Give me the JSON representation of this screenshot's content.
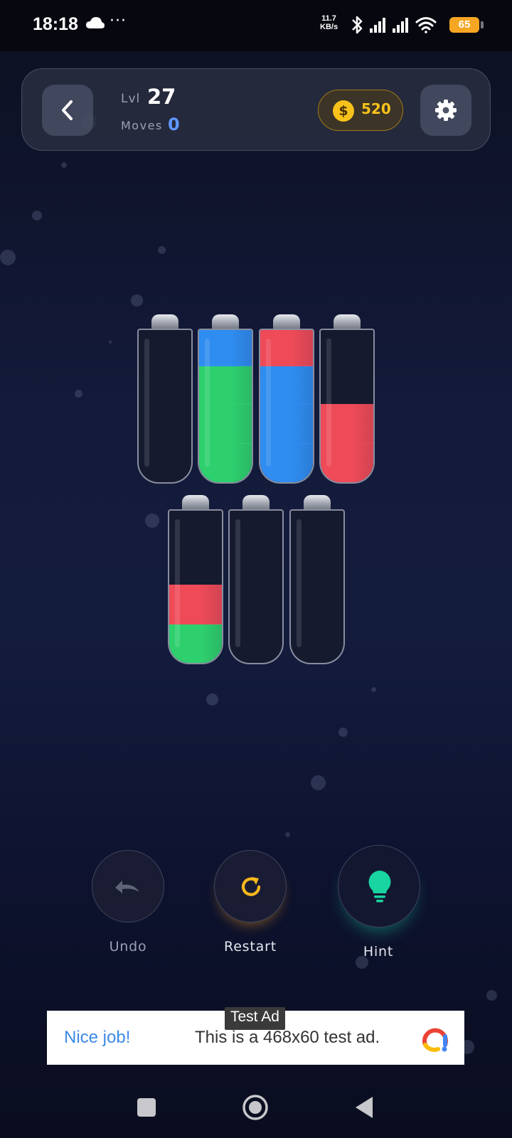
{
  "status_bar": {
    "time": "18:18",
    "more": "···",
    "speed_value": "11.7",
    "speed_unit": "KB/s",
    "battery": "65",
    "icons": [
      "cloud-icon",
      "bluetooth-icon",
      "signal-icon",
      "signal-icon",
      "wifi-icon",
      "battery-icon"
    ]
  },
  "header": {
    "level_label": "Lvl",
    "level_value": "27",
    "moves_label": "Moves",
    "moves_value": "0",
    "coins_symbol": "$",
    "coins_value": "520",
    "back_icon": "chevron-left-icon",
    "settings_icon": "gear-icon"
  },
  "colors": {
    "blue": "#2f8cf0",
    "green": "#2ed06e",
    "red": "#ee4a58",
    "gold": "#f8c21c",
    "hint": "#18d4a0",
    "accent": "#5f97ff"
  },
  "tubes": [
    {
      "row": 1,
      "layers": []
    },
    {
      "row": 1,
      "layers": [
        "green",
        "green",
        "green",
        "blue"
      ]
    },
    {
      "row": 1,
      "layers": [
        "blue",
        "blue",
        "blue",
        "red"
      ]
    },
    {
      "row": 1,
      "layers": [
        "red",
        "red"
      ]
    },
    {
      "row": 2,
      "layers": [
        "green",
        "red"
      ]
    },
    {
      "row": 2,
      "layers": []
    },
    {
      "row": 2,
      "layers": []
    }
  ],
  "tube_capacity": 4,
  "actions": {
    "undo_label": "Undo",
    "restart_label": "Restart",
    "hint_label": "Hint"
  },
  "ad": {
    "tag": "Test Ad",
    "headline": "Nice job!",
    "body": "This is a 468x60 test ad."
  },
  "nav": [
    "recents-icon",
    "home-icon",
    "back-icon"
  ]
}
